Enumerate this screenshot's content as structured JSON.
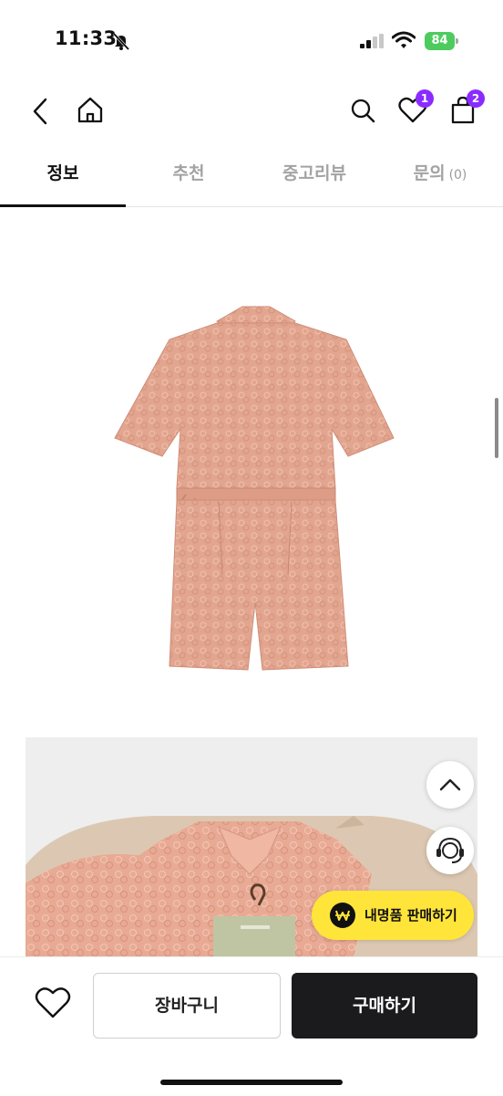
{
  "status_bar": {
    "time": "11:33",
    "battery": "84"
  },
  "nav": {
    "wishlist_badge": "1",
    "cart_badge": "2"
  },
  "tabs": [
    {
      "label": "정보",
      "active": true
    },
    {
      "label": "추천",
      "active": false
    },
    {
      "label": "중고리뷰",
      "active": false
    },
    {
      "label": "문의",
      "count": "(0)",
      "active": false
    }
  ],
  "floating": {
    "sell_label": "내명품 판매하기"
  },
  "bottom_bar": {
    "cart_label": "장바구니",
    "buy_label": "구매하기"
  },
  "colors": {
    "badge": "#8a2bff",
    "sell_button": "#ffe53a",
    "buy_button": "#1b1b1d",
    "product": "#e3a793"
  }
}
